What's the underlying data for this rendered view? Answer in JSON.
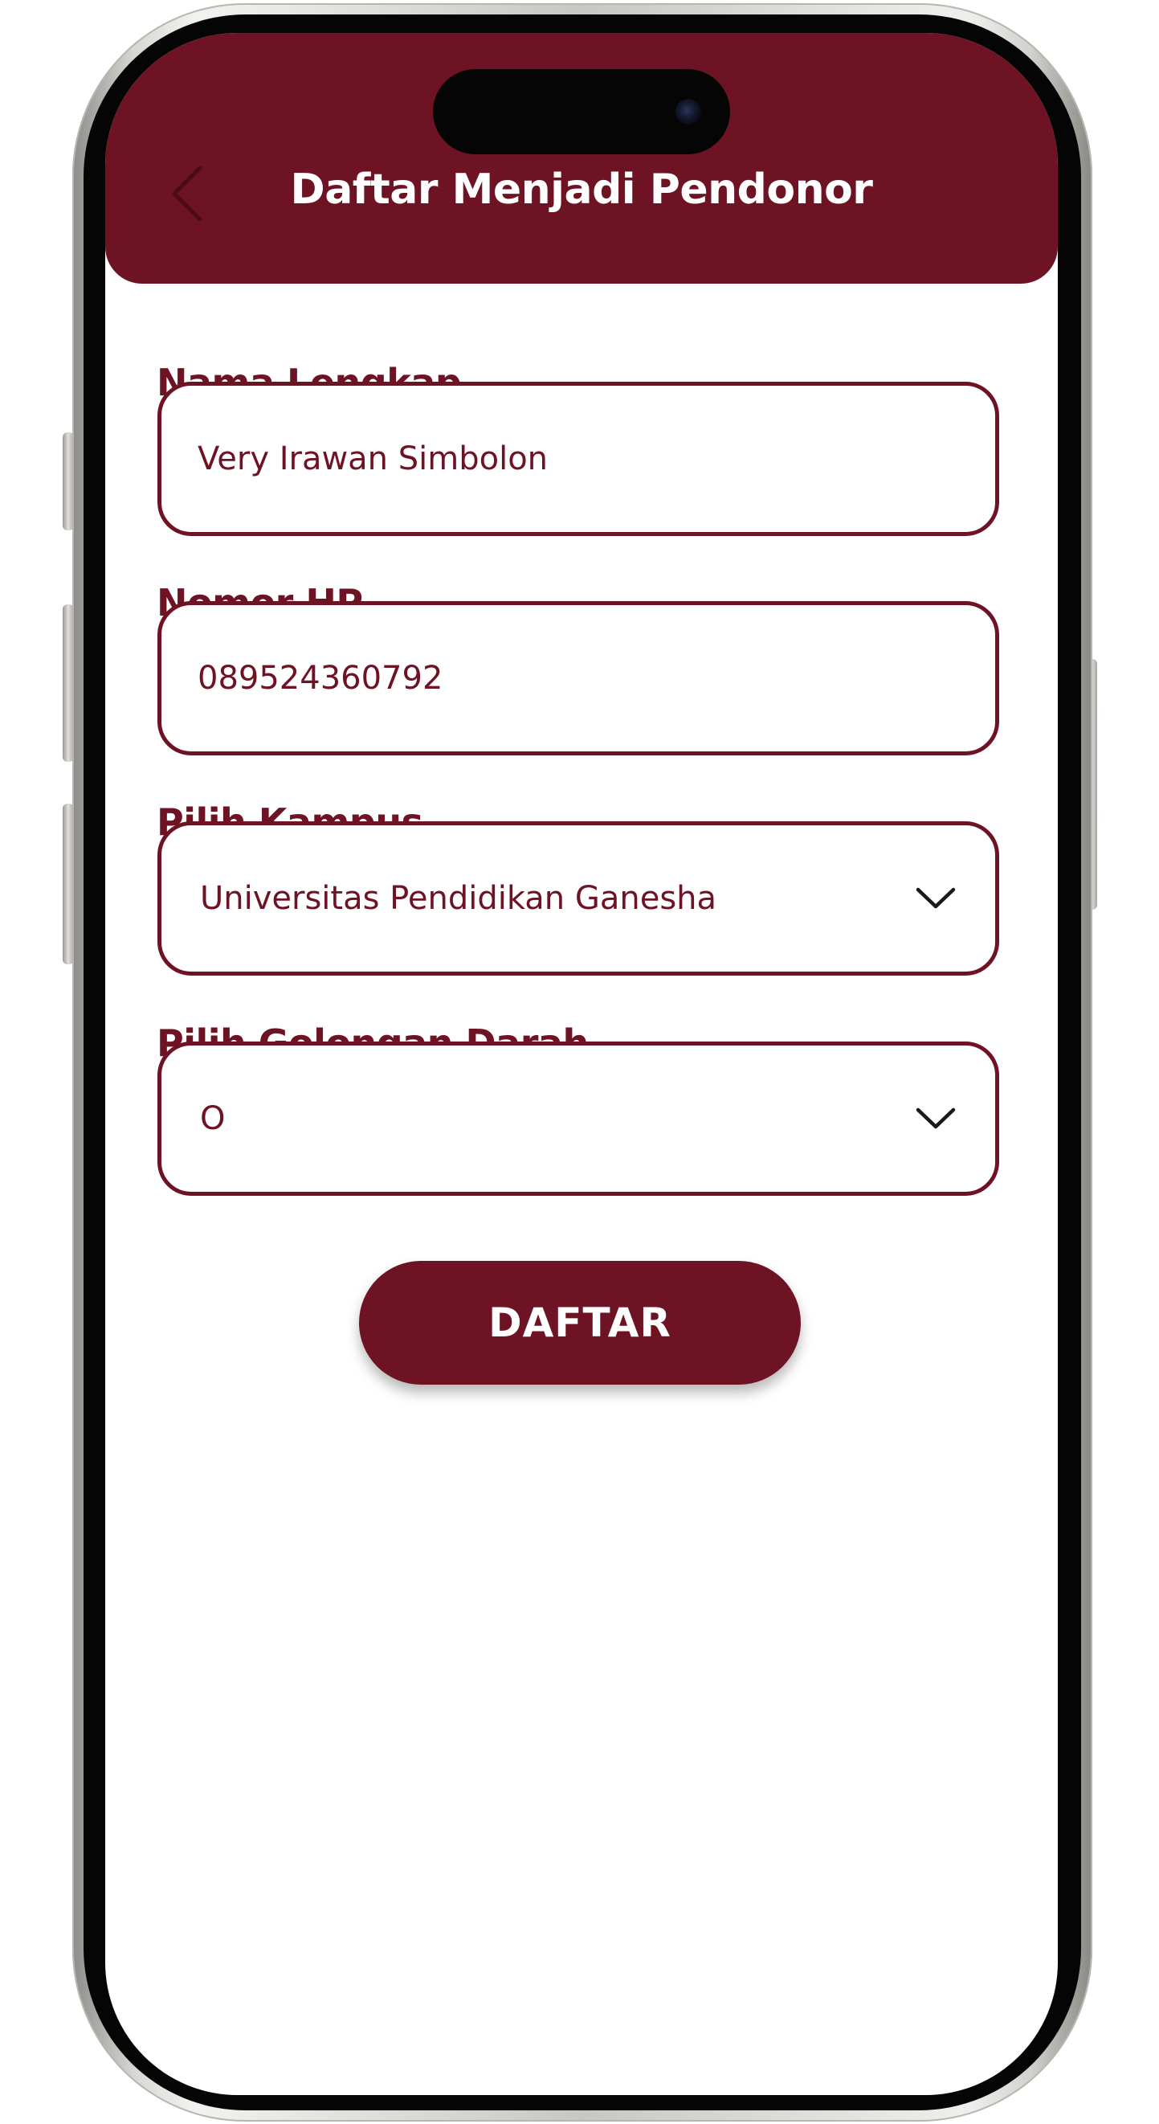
{
  "header": {
    "title": "Daftar Menjadi Pendonor",
    "back_icon": "chevron-left-icon",
    "background_color": "#6e1323"
  },
  "form": {
    "fields": [
      {
        "label": "Nama Lengkap",
        "value": "Very Irawan Simbolon",
        "type": "text"
      },
      {
        "label": "Nomor HP",
        "value": "089524360792",
        "type": "tel"
      },
      {
        "label": "Pilih Kampus",
        "value": "Universitas Pendidikan Ganesha",
        "type": "select",
        "icon": "chevron-down-icon"
      },
      {
        "label": "Pilih Golongan Darah",
        "value": "O",
        "type": "select",
        "icon": "chevron-down-icon"
      }
    ],
    "submit_label": "DAFTAR"
  },
  "theme": {
    "accent": "#6e1323",
    "background": "#ffffff"
  }
}
